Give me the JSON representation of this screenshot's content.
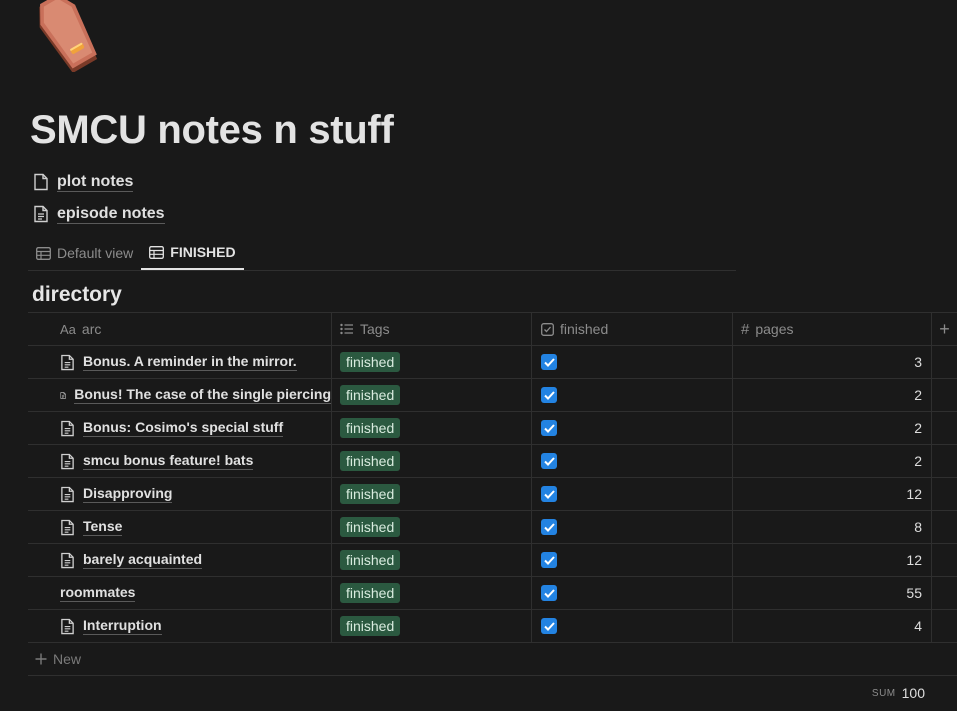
{
  "page": {
    "icon": "coffin-icon",
    "title": "SMCU notes n stuff"
  },
  "sub_pages": [
    {
      "label": "plot notes",
      "icon": "page-icon"
    },
    {
      "label": "episode notes",
      "icon": "page-text-icon"
    }
  ],
  "views": [
    {
      "label": "Default view",
      "icon": "table-icon",
      "active": false
    },
    {
      "label": "FINISHED",
      "icon": "table-icon",
      "active": true
    }
  ],
  "database": {
    "title": "directory",
    "columns": {
      "arc": {
        "label": "arc",
        "icon": "Aa"
      },
      "tags": {
        "label": "Tags",
        "icon": "list-icon"
      },
      "finished": {
        "label": "finished",
        "icon": "checkbox-icon"
      },
      "pages": {
        "label": "pages",
        "icon": "#"
      }
    },
    "add_property_icon": "+",
    "rows": [
      {
        "arc": "Bonus. A reminder in the mirror.",
        "has_doc_icon": true,
        "tag": "finished",
        "finished": true,
        "pages": "3"
      },
      {
        "arc": "Bonus! The case of the single piercing",
        "has_doc_icon": true,
        "tag": "finished",
        "finished": true,
        "pages": "2"
      },
      {
        "arc": "Bonus: Cosimo's special stuff",
        "has_doc_icon": true,
        "tag": "finished",
        "finished": true,
        "pages": "2"
      },
      {
        "arc": "smcu bonus feature! bats",
        "has_doc_icon": true,
        "tag": "finished",
        "finished": true,
        "pages": "2"
      },
      {
        "arc": "Disapproving",
        "has_doc_icon": true,
        "tag": "finished",
        "finished": true,
        "pages": "12"
      },
      {
        "arc": "Tense",
        "has_doc_icon": true,
        "tag": "finished",
        "finished": true,
        "pages": "8"
      },
      {
        "arc": "barely acquainted",
        "has_doc_icon": true,
        "tag": "finished",
        "finished": true,
        "pages": "12"
      },
      {
        "arc": "roommates",
        "has_doc_icon": false,
        "tag": "finished",
        "finished": true,
        "pages": "55"
      },
      {
        "arc": "Interruption",
        "has_doc_icon": true,
        "tag": "finished",
        "finished": true,
        "pages": "4"
      }
    ],
    "new_label": "New",
    "sum_label": "SUM",
    "sum_value": "100"
  },
  "colors": {
    "background": "#191919",
    "tag_green": "#2b5940",
    "checkbox_blue": "#2383e2"
  }
}
